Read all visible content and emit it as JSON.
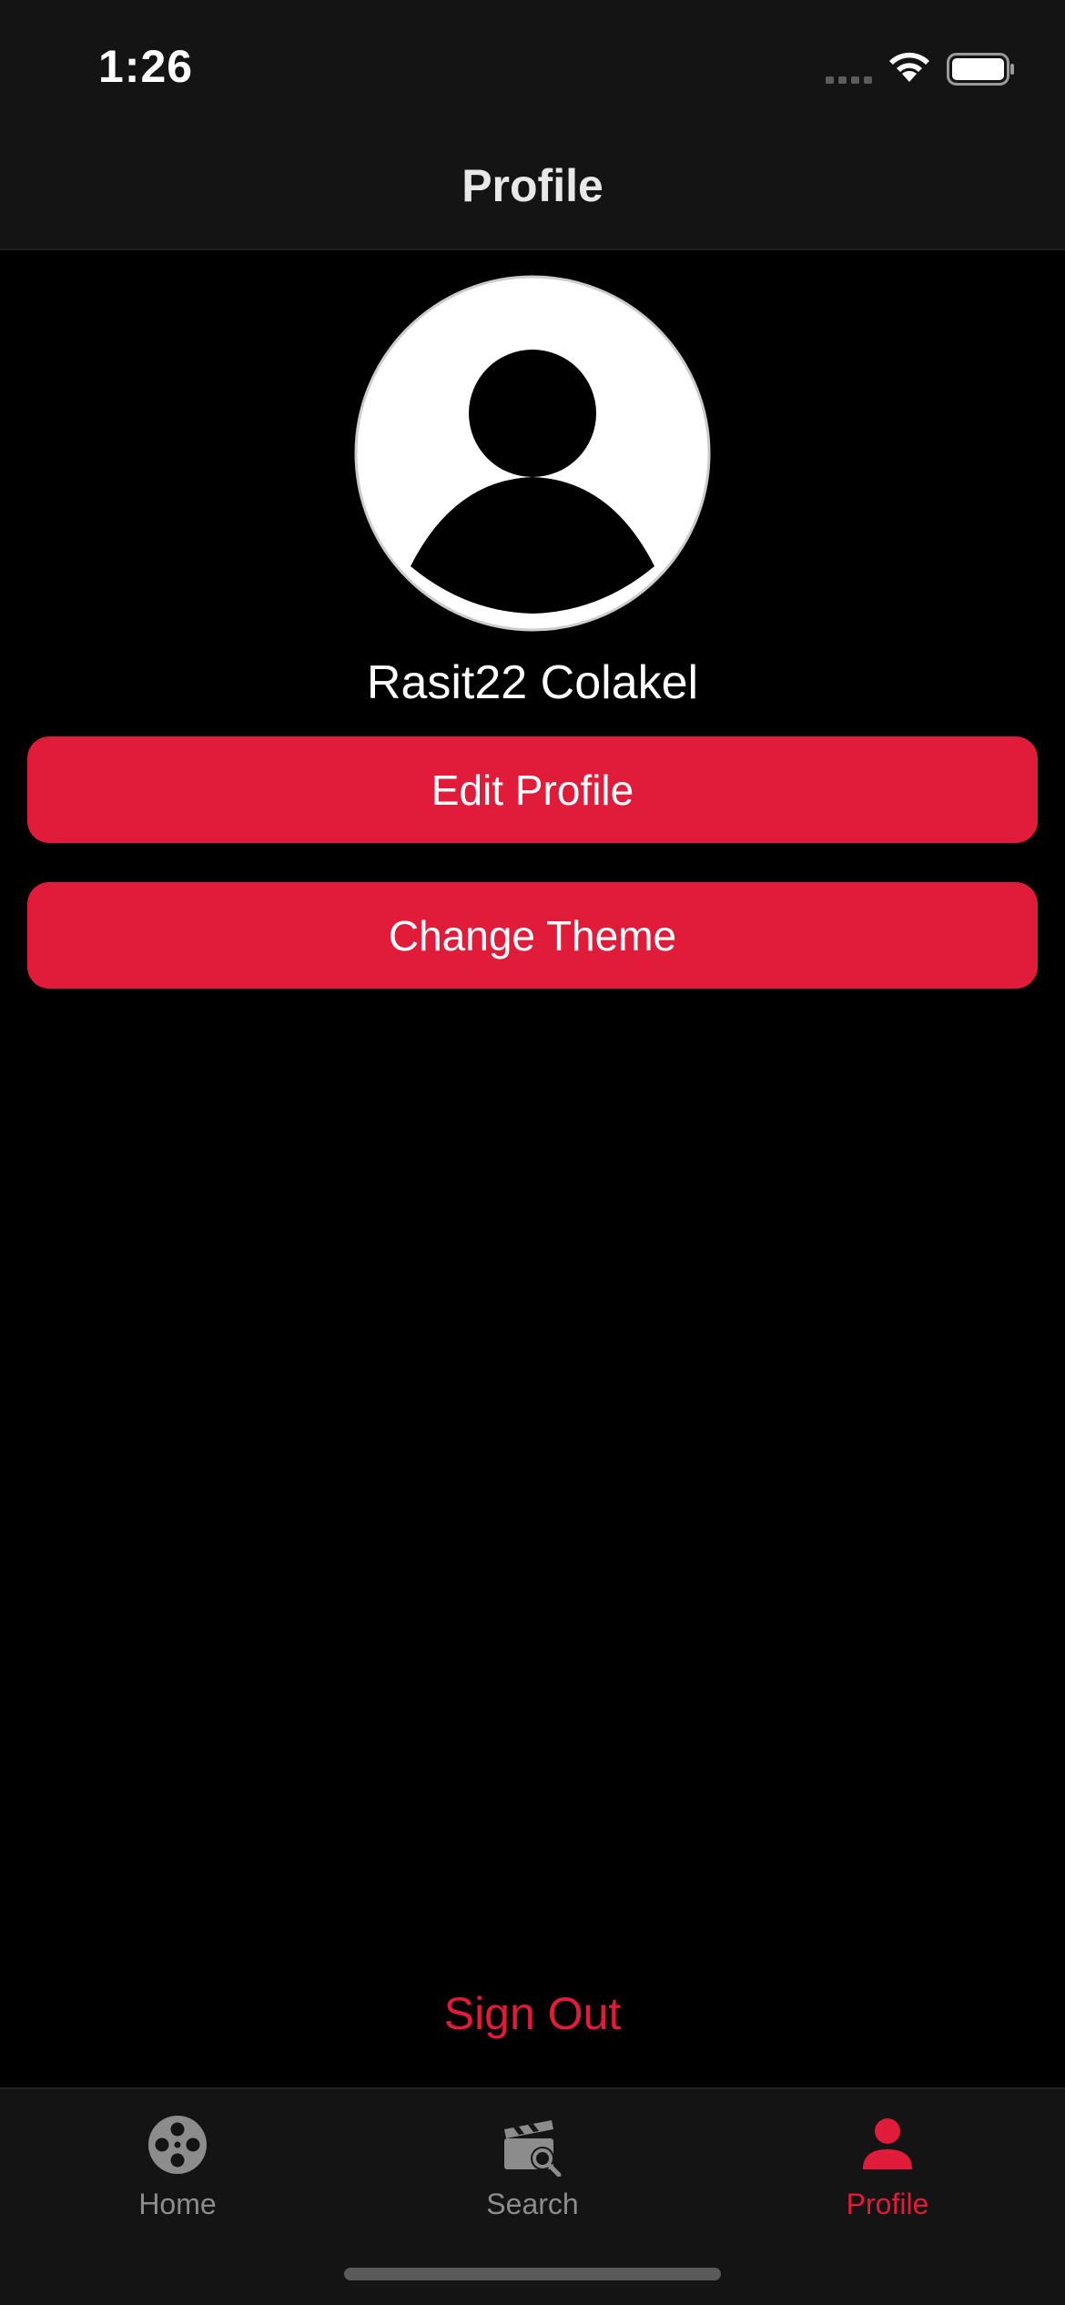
{
  "status_bar": {
    "time": "1:26"
  },
  "nav": {
    "title": "Profile"
  },
  "profile": {
    "user_name": "Rasit22 Colakel",
    "edit_label": "Edit Profile",
    "theme_label": "Change Theme",
    "sign_out_label": "Sign Out"
  },
  "tabs": [
    {
      "label": "Home",
      "icon": "film-reel-icon",
      "active": false
    },
    {
      "label": "Search",
      "icon": "clapper-search-icon",
      "active": false
    },
    {
      "label": "Profile",
      "icon": "person-icon",
      "active": true
    }
  ],
  "colors": {
    "accent": "#e11b3a",
    "background": "#000000",
    "bar_background": "#141414",
    "inactive_tab": "#8c8c8c"
  }
}
